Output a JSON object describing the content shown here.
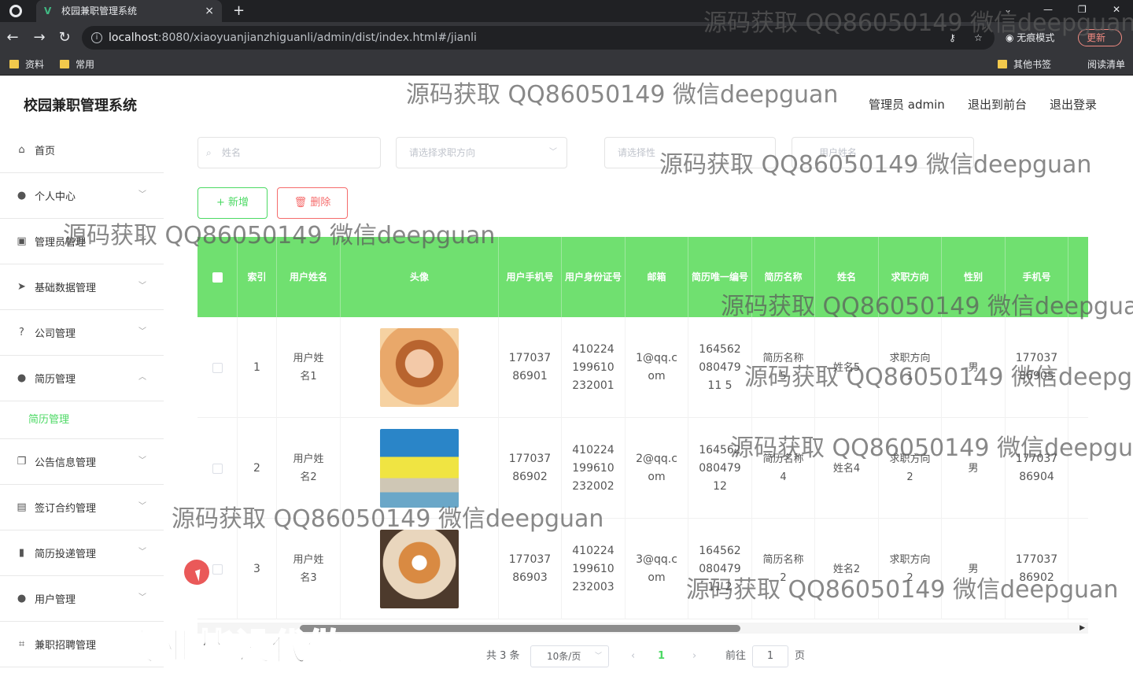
{
  "browser": {
    "tab_title": "校园兼职管理系统",
    "tab_close": "×",
    "new_tab": "+",
    "url_host": "localhost",
    "url_rest": ":8080/xiaoyuanjianzhiguanli/admin/dist/index.html#/jianli",
    "incognito_label": "无痕模式",
    "update_label": "更新",
    "bookmarks": [
      "资料",
      "常用"
    ],
    "bookmarks_right": [
      "其他书签",
      "阅读清单"
    ]
  },
  "header": {
    "app_title": "校园兼职管理系统",
    "admin_label": "管理员 admin",
    "front_link": "退出到前台",
    "logout_link": "退出登录"
  },
  "sidebar": {
    "items": [
      {
        "label": "首页",
        "icon": "home-icon"
      },
      {
        "label": "个人中心",
        "icon": "user-icon"
      },
      {
        "label": "管理员管理",
        "icon": "chart-icon"
      },
      {
        "label": "基础数据管理",
        "icon": "send-icon"
      },
      {
        "label": "公司管理",
        "icon": "help-icon"
      },
      {
        "label": "简历管理",
        "icon": "user-icon"
      },
      {
        "label": "公告信息管理",
        "icon": "copy-icon"
      },
      {
        "label": "签订合约管理",
        "icon": "card-icon"
      },
      {
        "label": "简历投递管理",
        "icon": "bar-chart-icon"
      },
      {
        "label": "用户管理",
        "icon": "user-icon"
      },
      {
        "label": "兼职招聘管理",
        "icon": "crop-icon"
      }
    ],
    "active_sub": "简历管理"
  },
  "search": {
    "name_placeholder": "姓名",
    "direction_placeholder": "请选择求职方向",
    "gender_placeholder": "请选择性",
    "other_placeholder": "用户姓名"
  },
  "toolbar": {
    "add_label": "+ 新增",
    "delete_label": "删除"
  },
  "table": {
    "columns": [
      "索引",
      "用户姓名",
      "头像",
      "用户手机号",
      "用户身份证号",
      "邮箱",
      "简历唯一编号",
      "简历名称",
      "姓名",
      "求职方向",
      "性别",
      "手机号"
    ],
    "rows": [
      {
        "index": "1",
        "user_name": "用户姓名1",
        "phone": "17703786901",
        "id_card": "410224199610232001",
        "email": "1@qq.com",
        "resume_no": "16456208047911 5",
        "resume_name": "简历名称5",
        "name": "姓名5",
        "direction": "求职方向1",
        "gender": "男",
        "mobile": "17703786905"
      },
      {
        "index": "2",
        "user_name": "用户姓名2",
        "phone": "17703786902",
        "id_card": "410224199610232002",
        "email": "2@qq.com",
        "resume_no": "16456208047912",
        "resume_name": "简历名称4",
        "name": "姓名4",
        "direction": "求职方向2",
        "gender": "男",
        "mobile": "17703786904"
      },
      {
        "index": "3",
        "user_name": "用户姓名3",
        "phone": "17703786903",
        "id_card": "410224199610232003",
        "email": "3@qq.com",
        "resume_no": "16456208047911 2",
        "resume_name": "简历名称2",
        "name": "姓名2",
        "direction": "求职方向2",
        "gender": "男",
        "mobile": "17703786902"
      }
    ]
  },
  "pagination": {
    "total": "共 3 条",
    "page_size": "10条/页",
    "current": "1",
    "goto_label": "前往",
    "goto_value": "1",
    "page_unit": "页"
  },
  "overlay": {
    "watermark": "源码获取 QQ86050149 微信deepguan",
    "promo": "专业毕设代做"
  }
}
